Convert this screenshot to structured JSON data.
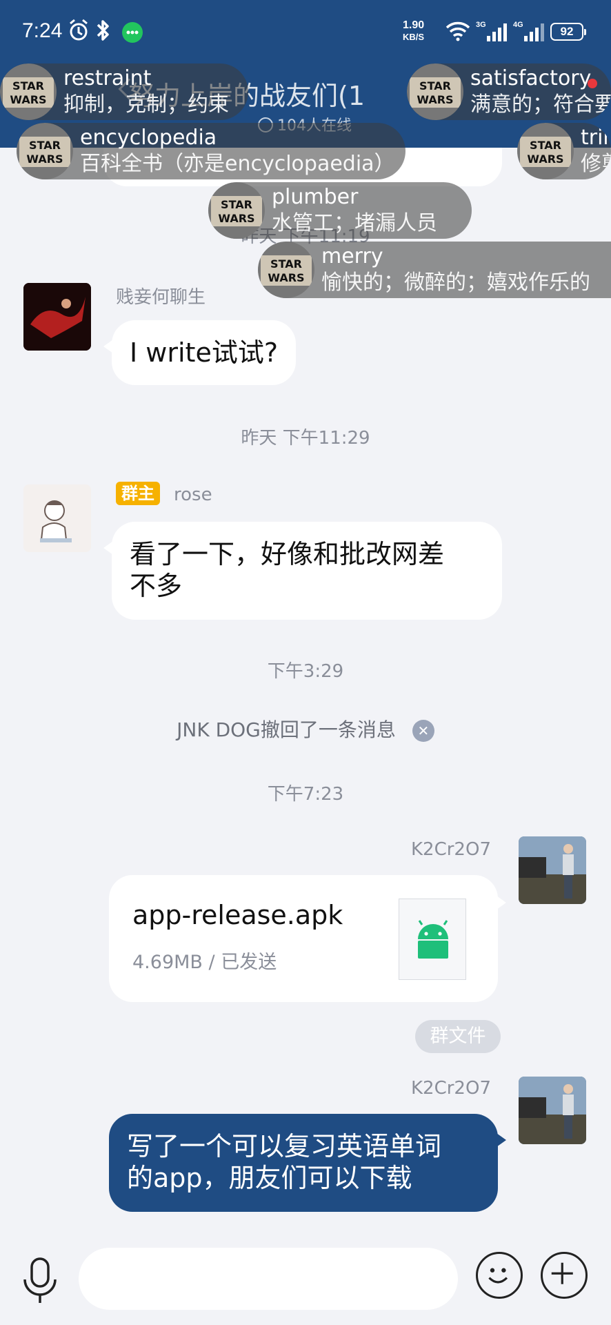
{
  "status_bar": {
    "time": "7:24",
    "net_speed_value": "1.90",
    "net_speed_unit": "KB/S",
    "net1": "3G",
    "net2": "4G",
    "battery": "92"
  },
  "header": {
    "title": "努力上岸的战友们(1",
    "online": "104人在线"
  },
  "danmaku": [
    {
      "word": "restraint",
      "meaning": "抑制，克制；约束"
    },
    {
      "word": "satisfactory",
      "meaning": "满意的；符合要"
    },
    {
      "word": "encyclopedia",
      "meaning": "百科全书（亦是encyclopaedia）"
    },
    {
      "word": "trim",
      "meaning": "修剪"
    },
    {
      "word": "plumber",
      "meaning": "水管工；堵漏人员"
    },
    {
      "word": "merry",
      "meaning": "愉快的；微醉的；嬉戏作乐的"
    }
  ],
  "messages": {
    "ts_partial": "昨天 下午11:19",
    "msg1": {
      "sender": "贱妾何聊生",
      "text": "I write试试?"
    },
    "ts2": "昨天 下午11:29",
    "msg2": {
      "badge": "群主",
      "sender": "rose",
      "line1": "看了一下，好像和批改网差",
      "line2": "不多"
    },
    "ts3": "下午3:29",
    "recall": "JNK DOG撤回了一条消息",
    "ts4": "下午7:23",
    "msg3": {
      "sender": "K2Cr2O7",
      "file_name": "app-release.apk",
      "file_meta": "4.69MB / 已发送",
      "group_file": "群文件"
    },
    "msg4": {
      "sender": "K2Cr2O7",
      "line1": "写了一个可以复习英语单词",
      "line2": "的app，朋友们可以下载"
    }
  },
  "icons": {
    "alarm": "alarm-icon",
    "bluetooth": "bluetooth-icon",
    "wechat": "chat-app-icon",
    "wifi": "wifi-icon",
    "mic": "microphone-icon",
    "emoji": "emoji-icon",
    "plus": "plus-icon",
    "android": "android-icon"
  },
  "colors": {
    "header_bg": "#1f4c83",
    "self_bubble": "#1f4c83",
    "owner_badge": "#f6b100",
    "android_green": "#1fbf7a"
  }
}
